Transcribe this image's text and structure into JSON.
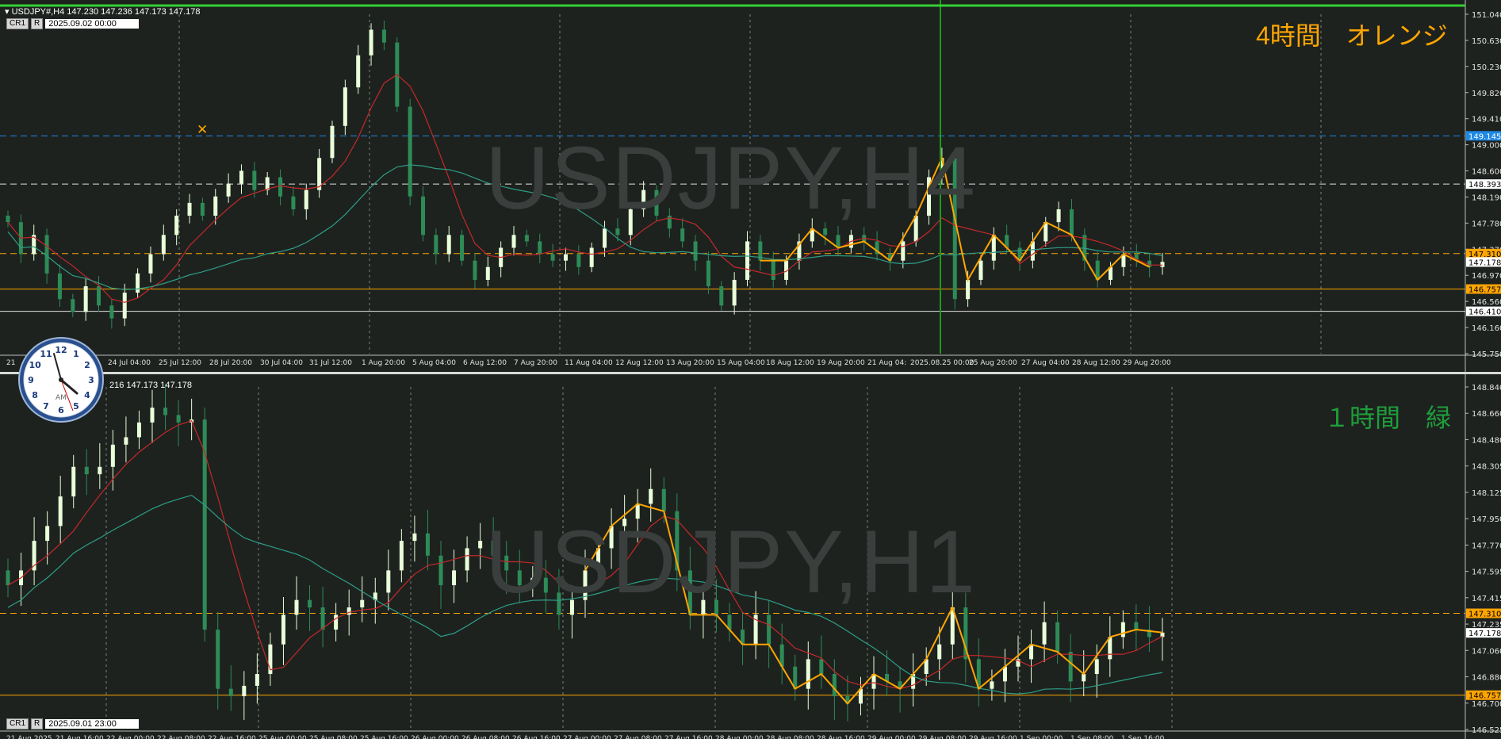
{
  "colors": {
    "background": "#1d221f",
    "bull_candle": "#e9ffd9",
    "bear_candle": "#2e8b57",
    "ma_fast": "#c62828",
    "ma_slow": "#2e9d86",
    "zigzag": "#ffa500",
    "level_orange": "#ffa500",
    "level_blue": "#1e88e5",
    "label_h4": "#ffa500",
    "label_h1": "#1f9d3a"
  },
  "h4": {
    "header_symbol": "USDJPY#,H4",
    "header_ohlc": "147.230 147.236 147.173 147.178",
    "tf_btn_cr1": "CR1",
    "tf_btn_r": "R",
    "date_box": "2025.09.02 00:00",
    "watermark": "USDJPY,H4",
    "big_label": "4時間　オレンジ",
    "price_labels": [
      "151.040",
      "150.630",
      "150.230",
      "149.820",
      "149.410",
      "149.000",
      "148.600",
      "148.190",
      "147.780",
      "147.370",
      "146.970",
      "146.560",
      "146.160",
      "145.750"
    ],
    "highlight_labels": [
      {
        "text": "149.145",
        "type": "blue"
      },
      {
        "text": "148.393",
        "type": "white"
      },
      {
        "text": "147.310",
        "type": "orange"
      },
      {
        "text": "147.178",
        "type": "white"
      },
      {
        "text": "146.757",
        "type": "orange"
      },
      {
        "text": "146.410",
        "type": "white"
      }
    ],
    "time_labels": [
      "21 ",
      "24 Jul 04:00",
      "25 Jul 12:00",
      "28 Jul 20:00",
      "30 Jul 04:00",
      "31 Jul 12:00",
      "1 Aug 20:00",
      "5 Aug 04:00",
      "6 Aug 12:00",
      "7 Aug 20:00",
      "11 Aug 04:00",
      "12 Aug 12:00",
      "13 Aug 20:00",
      "15 Aug 04:00",
      "18 Aug 12:00",
      "19 Aug 20:00",
      "21 Aug 04:",
      "2025.08.25 00:00",
      "25 Aug 20:00",
      "27 Aug 04:00",
      "28 Aug 12:00",
      "29 Aug 20:00"
    ],
    "chart_data": {
      "type": "candlestick",
      "timeframe": "H4",
      "symbol": "USDJPY",
      "ylim": [
        145.75,
        151.04
      ],
      "horizontal_levels": [
        149.145,
        148.393,
        147.31,
        146.757,
        146.41
      ],
      "close_path": [
        147.8,
        147.3,
        147.6,
        147.0,
        146.6,
        146.4,
        146.8,
        146.5,
        146.3,
        146.7,
        147.0,
        147.3,
        147.6,
        147.9,
        148.1,
        147.9,
        148.2,
        148.4,
        148.6,
        148.3,
        148.5,
        148.2,
        148.0,
        148.3,
        148.8,
        149.3,
        149.9,
        150.4,
        150.8,
        150.6,
        149.6,
        148.2,
        147.6,
        147.3,
        147.6,
        147.2,
        146.9,
        147.1,
        147.4,
        147.6,
        147.5,
        147.3,
        147.2,
        147.3,
        147.1,
        147.4,
        147.7,
        147.6,
        148.0,
        148.3,
        147.9,
        147.7,
        147.5,
        147.2,
        146.8,
        146.5,
        146.9,
        147.5,
        147.2,
        146.9,
        147.2,
        147.5,
        147.7,
        147.6,
        147.4,
        147.6,
        147.5,
        147.3,
        147.2,
        147.5,
        147.9,
        148.5,
        148.8,
        146.6,
        146.9,
        147.2,
        147.6,
        147.4,
        147.2,
        147.5,
        147.8,
        148.0,
        147.6,
        147.2,
        146.9,
        147.1,
        147.3,
        147.2,
        147.1,
        147.18
      ]
    }
  },
  "h1": {
    "header_ohlc": "216 147.173 147.178",
    "tf_btn_cr1": "CR1",
    "tf_btn_r": "R",
    "date_box": "2025.09.01 23:00",
    "watermark": "USDJPY,H1",
    "big_label": "１時間　緑",
    "clock_ampm": "AM",
    "price_labels": [
      "148.840",
      "148.660",
      "148.480",
      "148.305",
      "148.125",
      "147.950",
      "147.770",
      "147.595",
      "147.415",
      "147.235",
      "147.060",
      "146.880",
      "146.700",
      "146.525"
    ],
    "highlight_labels": [
      {
        "text": "147.310",
        "type": "orange"
      },
      {
        "text": "147.178",
        "type": "white"
      },
      {
        "text": "146.757",
        "type": "orange"
      }
    ],
    "time_labels": [
      "21 Aug 2025",
      "21 Aug 16:00",
      "22 Aug 00:00",
      "22 Aug 08:00",
      "22 Aug 16:00",
      "25 Aug 00:00",
      "25 Aug 08:00",
      "25 Aug 16:00",
      "26 Aug 00:00",
      "26 Aug 08:00",
      "26 Aug 16:00",
      "27 Aug 00:00",
      "27 Aug 08:00",
      "27 Aug 16:00",
      "28 Aug 00:00",
      "28 Aug 08:00",
      "28 Aug 16:00",
      "29 Aug 00:00",
      "29 Aug 08:00",
      "29 Aug 16:00",
      "1 Sep 00:00",
      "1 Sep 08:00",
      "1 Sep 16:00"
    ],
    "chart_data": {
      "type": "candlestick",
      "timeframe": "H1",
      "symbol": "USDJPY",
      "ylim": [
        146.525,
        148.84
      ],
      "horizontal_levels": [
        147.31,
        146.757
      ],
      "close_path": [
        147.5,
        147.6,
        147.8,
        147.9,
        148.1,
        148.3,
        148.25,
        148.3,
        148.45,
        148.5,
        148.6,
        148.7,
        148.65,
        148.6,
        148.62,
        147.2,
        146.8,
        146.75,
        146.82,
        146.9,
        147.1,
        147.3,
        147.4,
        147.35,
        147.2,
        147.3,
        147.35,
        147.4,
        147.45,
        147.6,
        147.8,
        147.85,
        147.7,
        147.5,
        147.6,
        147.75,
        147.8,
        147.7,
        147.6,
        147.5,
        147.55,
        147.45,
        147.3,
        147.4,
        147.6,
        147.75,
        147.9,
        147.95,
        148.05,
        148.15,
        148.0,
        147.6,
        147.3,
        147.4,
        147.3,
        147.2,
        147.1,
        147.3,
        147.1,
        146.95,
        146.8,
        147.0,
        146.9,
        146.75,
        146.7,
        146.8,
        146.9,
        146.85,
        146.8,
        146.9,
        147.0,
        147.1,
        147.35,
        147.0,
        146.8,
        146.85,
        146.95,
        147.0,
        147.1,
        147.25,
        147.05,
        146.85,
        146.9,
        147.0,
        147.15,
        147.25,
        147.2,
        147.15,
        147.18
      ]
    }
  }
}
